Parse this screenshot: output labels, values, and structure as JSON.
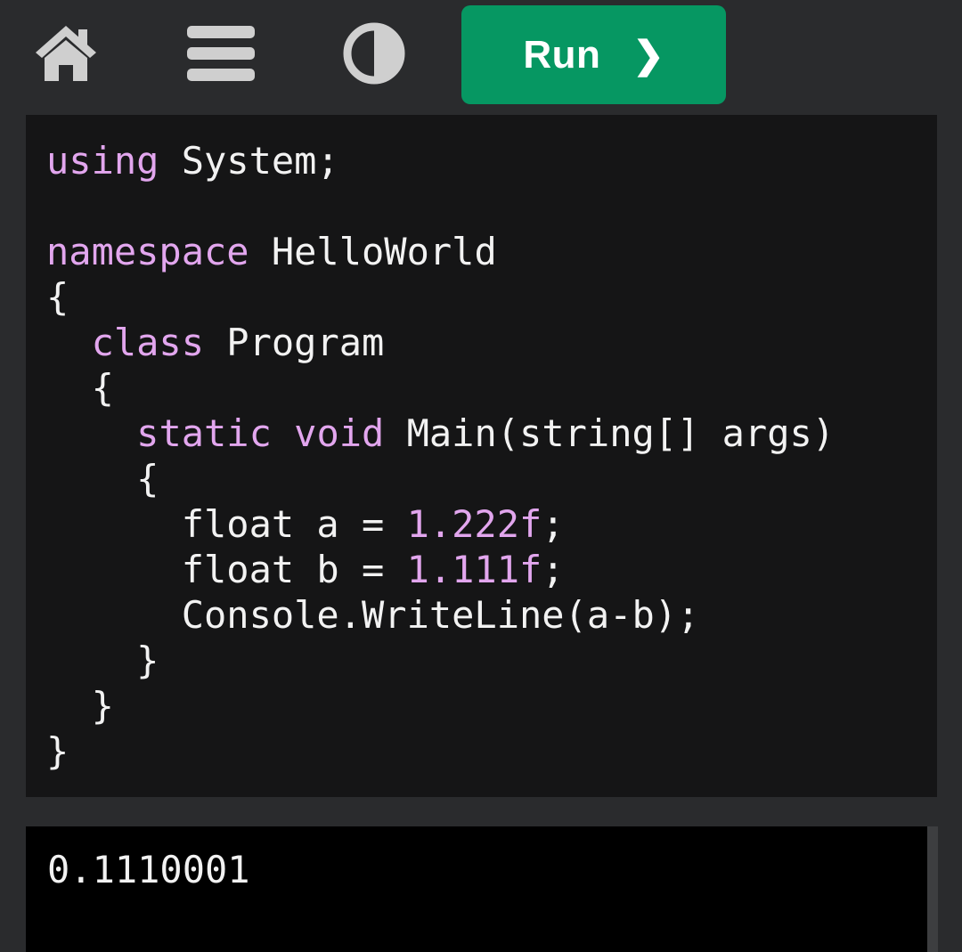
{
  "toolbar": {
    "home_icon": "home-icon",
    "menu_icon": "hamburger-menu-icon",
    "theme_icon": "contrast-toggle-icon",
    "run_label": "Run",
    "run_chevron": "❯"
  },
  "colors": {
    "background": "#2a2b2d",
    "editor_bg": "#151516",
    "console_bg": "#000000",
    "run_button": "#069762",
    "keyword": "#e2a6ee",
    "text": "#f2f2f2",
    "icon": "#cfcfcf"
  },
  "editor": {
    "lines": [
      [
        {
          "t": "using",
          "c": "kw"
        },
        {
          "t": " System;",
          "c": "plain"
        }
      ],
      [],
      [
        {
          "t": "namespace",
          "c": "kw"
        },
        {
          "t": " HelloWorld",
          "c": "plain"
        }
      ],
      [
        {
          "t": "{",
          "c": "plain"
        }
      ],
      [
        {
          "t": "  ",
          "c": "plain"
        },
        {
          "t": "class",
          "c": "kw"
        },
        {
          "t": " Program",
          "c": "plain"
        }
      ],
      [
        {
          "t": "  {",
          "c": "plain"
        }
      ],
      [
        {
          "t": "    ",
          "c": "plain"
        },
        {
          "t": "static",
          "c": "kw"
        },
        {
          "t": " ",
          "c": "plain"
        },
        {
          "t": "void",
          "c": "kw"
        },
        {
          "t": " Main(string[] args)",
          "c": "plain"
        }
      ],
      [
        {
          "t": "    {",
          "c": "plain"
        }
      ],
      [
        {
          "t": "      float a = ",
          "c": "plain"
        },
        {
          "t": "1.222f",
          "c": "num"
        },
        {
          "t": ";",
          "c": "plain"
        }
      ],
      [
        {
          "t": "      float b = ",
          "c": "plain"
        },
        {
          "t": "1.111f",
          "c": "num"
        },
        {
          "t": ";",
          "c": "plain"
        }
      ],
      [
        {
          "t": "      Console.WriteLine(a-b);",
          "c": "plain"
        }
      ],
      [
        {
          "t": "    }",
          "c": "plain"
        }
      ],
      [
        {
          "t": "  }",
          "c": "plain"
        }
      ],
      [
        {
          "t": "}",
          "c": "plain"
        }
      ]
    ]
  },
  "console": {
    "output": "0.1110001"
  }
}
